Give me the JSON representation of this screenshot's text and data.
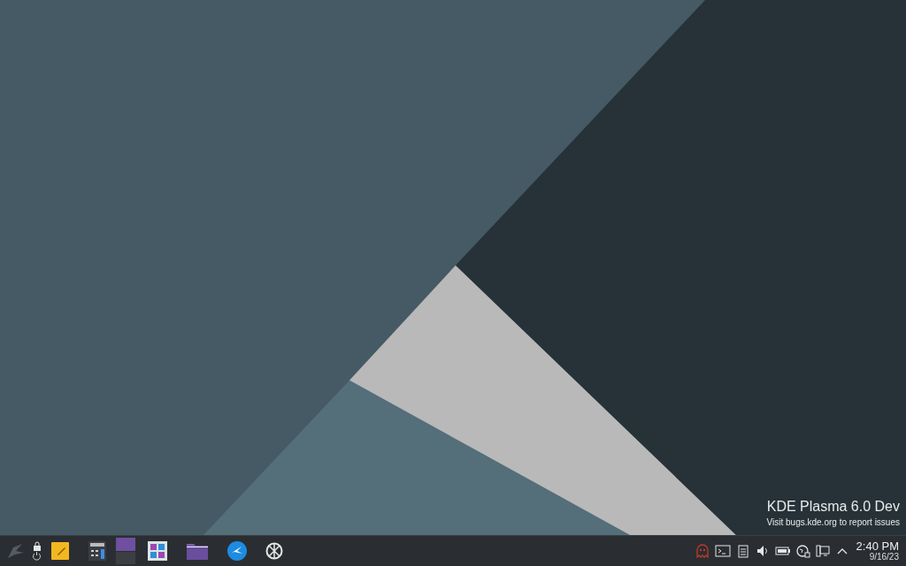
{
  "desktop": {
    "watermark_title": "KDE Plasma 6.0 Dev",
    "watermark_subtitle": "Visit bugs.kde.org to report issues"
  },
  "taskbar": {
    "pager": [
      {
        "selected": true
      },
      {
        "selected": false
      }
    ],
    "clock": {
      "time": "2:40 PM",
      "date": "9/16/23"
    }
  }
}
